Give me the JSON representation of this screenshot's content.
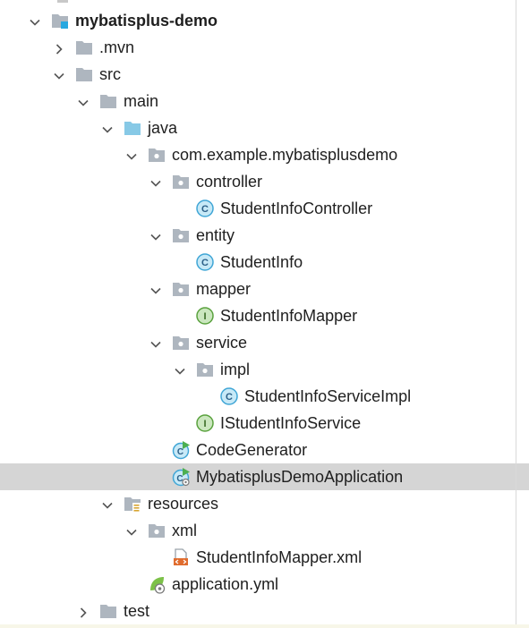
{
  "project_tree": {
    "items": [
      {
        "label": "mybatisplus-demo",
        "depth": 0,
        "expanded": true,
        "icon": "module-icon",
        "bold": true
      },
      {
        "label": ".mvn",
        "depth": 1,
        "expanded": false,
        "icon": "folder-icon"
      },
      {
        "label": "src",
        "depth": 1,
        "expanded": true,
        "icon": "folder-icon"
      },
      {
        "label": "main",
        "depth": 2,
        "expanded": true,
        "icon": "folder-icon"
      },
      {
        "label": "java",
        "depth": 3,
        "expanded": true,
        "icon": "source-folder-icon"
      },
      {
        "label": "com.example.mybatisplusdemo",
        "depth": 4,
        "expanded": true,
        "icon": "package-icon"
      },
      {
        "label": "controller",
        "depth": 5,
        "expanded": true,
        "icon": "package-icon"
      },
      {
        "label": "StudentInfoController",
        "depth": 6,
        "icon": "class-icon"
      },
      {
        "label": "entity",
        "depth": 5,
        "expanded": true,
        "icon": "package-icon"
      },
      {
        "label": "StudentInfo",
        "depth": 6,
        "icon": "class-icon"
      },
      {
        "label": "mapper",
        "depth": 5,
        "expanded": true,
        "icon": "package-icon"
      },
      {
        "label": "StudentInfoMapper",
        "depth": 6,
        "icon": "interface-icon"
      },
      {
        "label": "service",
        "depth": 5,
        "expanded": true,
        "icon": "package-icon"
      },
      {
        "label": "impl",
        "depth": 6,
        "expanded": true,
        "icon": "package-icon"
      },
      {
        "label": "StudentInfoServiceImpl",
        "depth": 7,
        "icon": "class-icon"
      },
      {
        "label": "IStudentInfoService",
        "depth": 6,
        "icon": "interface-icon"
      },
      {
        "label": "CodeGenerator",
        "depth": 5,
        "icon": "runnable-class-icon"
      },
      {
        "label": "MybatisplusDemoApplication",
        "depth": 5,
        "icon": "spring-boot-app-icon",
        "selected": true
      },
      {
        "label": "resources",
        "depth": 3,
        "expanded": true,
        "icon": "resources-folder-icon"
      },
      {
        "label": "xml",
        "depth": 4,
        "expanded": true,
        "icon": "package-icon"
      },
      {
        "label": "StudentInfoMapper.xml",
        "depth": 5,
        "icon": "xml-file-icon"
      },
      {
        "label": "application.yml",
        "depth": 4,
        "icon": "yaml-config-icon"
      },
      {
        "label": "test",
        "depth": 2,
        "expanded": false,
        "icon": "folder-icon"
      }
    ]
  },
  "colors": {
    "selection_bg": "#d5d5d5",
    "folder": "#aeb6bf",
    "source_folder": "#87c9e6",
    "class": "#40a6d6",
    "class_bg": "#c7e9f7",
    "interface": "#5aa23e",
    "interface_bg": "#cbe7bf",
    "run_arrow": "#4caf50",
    "module_accent": "#29a8e0",
    "xml_accent": "#e06c2e"
  }
}
